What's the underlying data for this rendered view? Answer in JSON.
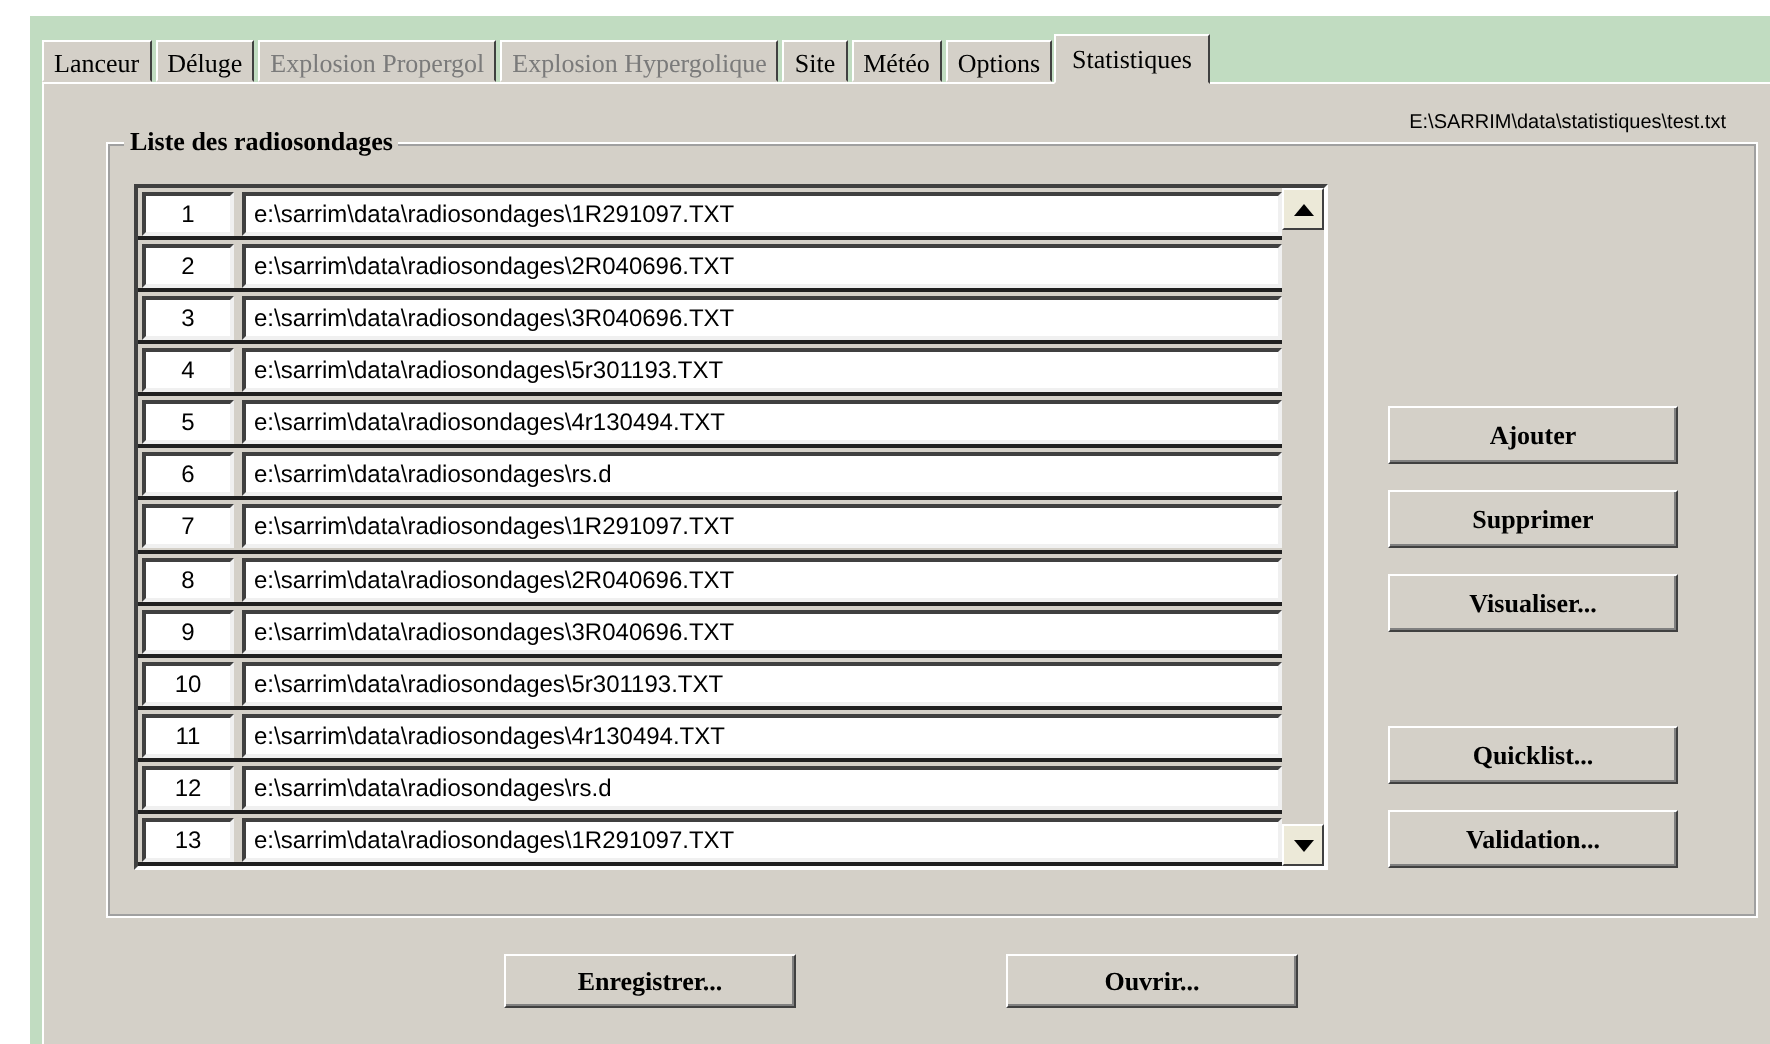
{
  "tabs": [
    {
      "label": "Lanceur",
      "selected": false,
      "disabled": false
    },
    {
      "label": "Déluge",
      "selected": false,
      "disabled": false
    },
    {
      "label": "Explosion Propergol",
      "selected": false,
      "disabled": true
    },
    {
      "label": "Explosion Hypergolique",
      "selected": false,
      "disabled": true
    },
    {
      "label": "Site",
      "selected": false,
      "disabled": false
    },
    {
      "label": "Météo",
      "selected": false,
      "disabled": false
    },
    {
      "label": "Options",
      "selected": false,
      "disabled": false
    },
    {
      "label": "Statistiques",
      "selected": true,
      "disabled": false
    }
  ],
  "file_path": "E:\\SARRIM\\data\\statistiques\\test.txt",
  "group": {
    "title": "Liste des radiosondages",
    "rows": [
      {
        "number": "1",
        "path": "e:\\sarrim\\data\\radiosondages\\1R291097.TXT"
      },
      {
        "number": "2",
        "path": "e:\\sarrim\\data\\radiosondages\\2R040696.TXT"
      },
      {
        "number": "3",
        "path": "e:\\sarrim\\data\\radiosondages\\3R040696.TXT"
      },
      {
        "number": "4",
        "path": "e:\\sarrim\\data\\radiosondages\\5r301193.TXT"
      },
      {
        "number": "5",
        "path": "e:\\sarrim\\data\\radiosondages\\4r130494.TXT"
      },
      {
        "number": "6",
        "path": "e:\\sarrim\\data\\radiosondages\\rs.d"
      },
      {
        "number": "7",
        "path": "e:\\sarrim\\data\\radiosondages\\1R291097.TXT"
      },
      {
        "number": "8",
        "path": "e:\\sarrim\\data\\radiosondages\\2R040696.TXT"
      },
      {
        "number": "9",
        "path": "e:\\sarrim\\data\\radiosondages\\3R040696.TXT"
      },
      {
        "number": "10",
        "path": "e:\\sarrim\\data\\radiosondages\\5r301193.TXT"
      },
      {
        "number": "11",
        "path": "e:\\sarrim\\data\\radiosondages\\4r130494.TXT"
      },
      {
        "number": "12",
        "path": "e:\\sarrim\\data\\radiosondages\\rs.d"
      },
      {
        "number": "13",
        "path": "e:\\sarrim\\data\\radiosondages\\1R291097.TXT"
      }
    ],
    "side_buttons": [
      [
        "Ajouter",
        "Supprimer",
        "Visualiser..."
      ],
      [
        "Quicklist...",
        "Validation..."
      ]
    ]
  },
  "bottom_buttons": [
    "Enregistrer...",
    "Ouvrir..."
  ]
}
